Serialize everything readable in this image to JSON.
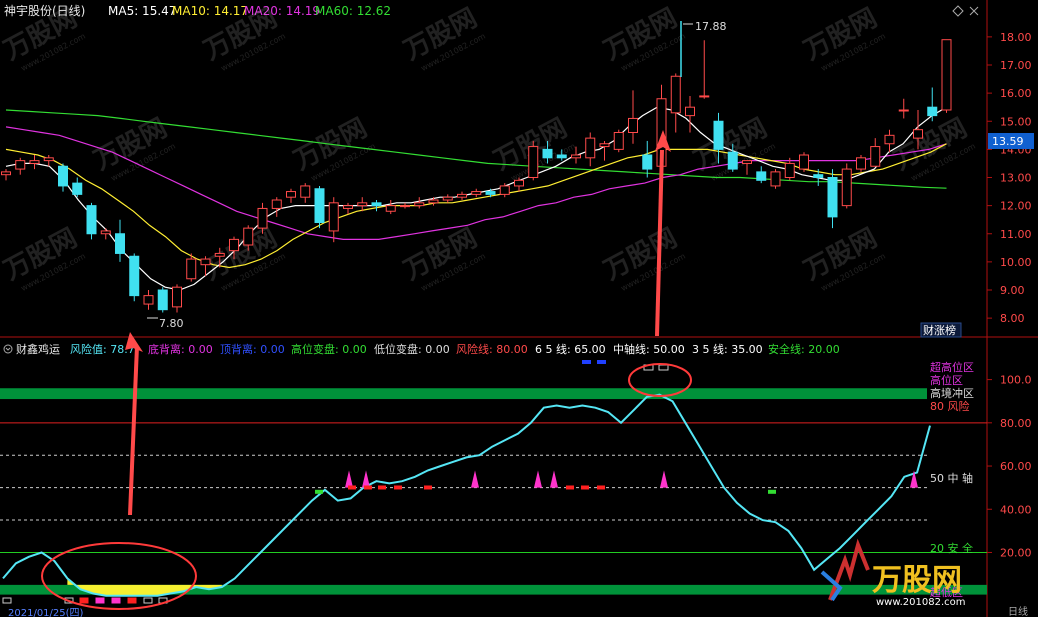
{
  "colors": {
    "background": "#000000",
    "border": "#b01010",
    "candle_up": "#ff4a4a",
    "candle_down": "#40e0f0",
    "ma5": "#ffffff",
    "ma10": "#ffee33",
    "ma20": "#e033e0",
    "ma60": "#33dd33",
    "risk_line": "#55e6f5",
    "green_band": "#00923a",
    "red_line": "#e02020",
    "safety_line": "#22cc22",
    "arrow": "#ff4a4a",
    "current_price_bg": "#1060d0"
  },
  "top_header": {
    "title": "神宇股份(日线)",
    "ma5": "MA5: 15.47",
    "ma10": "MA10: 14.17",
    "ma20": "MA20: 14.19",
    "ma60": "MA60: 12.62"
  },
  "top_panel": {
    "high_label": "17.88",
    "low_label": "7.80",
    "current_price": "13.59",
    "badge": "财涨榜",
    "y_ticks": [
      "18.00",
      "17.00",
      "16.00",
      "15.00",
      "14.00",
      "13.00",
      "12.00",
      "11.00",
      "10.00",
      "9.00",
      "8.00"
    ]
  },
  "bottom_header": {
    "title": "财鑫鸡运",
    "risk": "风险值: 78.7",
    "bottom_div": "底背离: 0.00",
    "top_div": "顶背离: 0.00",
    "high_change": "高位变盘: 0.00",
    "low_change": "低位变盘: 0.00",
    "risk_line": "风险线: 80.00",
    "line65": "6 5 线: 65.00",
    "mid_axis": "中轴线: 50.00",
    "line35": "3 5 线: 35.00",
    "safe_line": "安全线: 20.00"
  },
  "bottom_panel": {
    "zone_labels": {
      "super_high": "超高位区",
      "high_zone": "高位区",
      "high_rush": "高境冲区",
      "risk80": "80 风险",
      "mid50": "50 中 轴",
      "safe20": "20 安 全",
      "low_zone": "超低区"
    },
    "y_ticks": [
      "100.0",
      "80.00",
      "60.00",
      "40.00",
      "20.00"
    ],
    "date_label": "2021/01/25(四)",
    "period_label": "日线"
  },
  "watermark": {
    "brand": "万股网",
    "url": "www.201082.com"
  },
  "chart_data": [
    {
      "type": "candlestick",
      "title": "神宇股份(日线)",
      "ylim": [
        7.4,
        18.6
      ],
      "series_names": [
        "MA5",
        "MA10",
        "MA20",
        "MA60"
      ],
      "candles": [
        [
          13.1,
          13.3,
          12.9,
          13.2
        ],
        [
          13.3,
          13.7,
          13.1,
          13.6
        ],
        [
          13.5,
          13.8,
          13.3,
          13.6
        ],
        [
          13.6,
          13.8,
          13.4,
          13.7
        ],
        [
          13.4,
          13.5,
          12.5,
          12.7
        ],
        [
          12.8,
          13.0,
          12.3,
          12.4
        ],
        [
          12.0,
          12.1,
          10.8,
          11.0
        ],
        [
          11.0,
          11.2,
          10.8,
          11.1
        ],
        [
          11.0,
          11.5,
          10.0,
          10.3
        ],
        [
          10.2,
          10.3,
          8.6,
          8.8
        ],
        [
          8.5,
          9.0,
          8.3,
          8.8
        ],
        [
          9.0,
          9.1,
          8.2,
          8.3
        ],
        [
          8.4,
          9.2,
          8.2,
          9.1
        ],
        [
          9.4,
          10.3,
          9.3,
          10.1
        ],
        [
          9.9,
          10.2,
          9.5,
          10.1
        ],
        [
          10.2,
          10.5,
          9.8,
          10.3
        ],
        [
          10.4,
          10.9,
          10.1,
          10.8
        ],
        [
          10.6,
          11.3,
          10.4,
          11.2
        ],
        [
          11.2,
          12.1,
          11.0,
          11.9
        ],
        [
          11.9,
          12.3,
          11.6,
          12.2
        ],
        [
          12.3,
          12.6,
          12.1,
          12.5
        ],
        [
          12.3,
          12.8,
          12.1,
          12.7
        ],
        [
          12.6,
          12.7,
          11.2,
          11.4
        ],
        [
          11.1,
          12.3,
          10.7,
          12.1
        ],
        [
          11.9,
          12.1,
          11.7,
          12.0
        ],
        [
          12.0,
          12.3,
          11.8,
          12.1
        ],
        [
          12.1,
          12.2,
          11.8,
          12.0
        ],
        [
          11.8,
          12.2,
          11.7,
          12.0
        ],
        [
          12.0,
          12.1,
          11.9,
          12.0
        ],
        [
          12.0,
          12.3,
          11.9,
          12.1
        ],
        [
          12.1,
          12.3,
          12.0,
          12.2
        ],
        [
          12.2,
          12.4,
          12.1,
          12.3
        ],
        [
          12.3,
          12.5,
          12.2,
          12.4
        ],
        [
          12.4,
          12.6,
          12.3,
          12.5
        ],
        [
          12.5,
          12.6,
          12.3,
          12.4
        ],
        [
          12.4,
          12.8,
          12.3,
          12.7
        ],
        [
          12.7,
          13.0,
          12.5,
          12.9
        ],
        [
          13.0,
          14.3,
          12.9,
          14.1
        ],
        [
          14.0,
          14.3,
          13.5,
          13.7
        ],
        [
          13.8,
          14.0,
          13.6,
          13.7
        ],
        [
          13.7,
          14.1,
          13.5,
          13.8
        ],
        [
          13.7,
          14.6,
          13.4,
          14.4
        ],
        [
          14.1,
          14.3,
          13.6,
          14.2
        ],
        [
          14.0,
          14.7,
          13.9,
          14.6
        ],
        [
          14.6,
          16.1,
          14.2,
          15.1
        ],
        [
          13.8,
          14.3,
          13.0,
          13.3
        ],
        [
          13.4,
          16.3,
          13.2,
          15.8
        ],
        [
          15.3,
          16.7,
          14.6,
          16.6
        ],
        [
          15.2,
          15.9,
          14.6,
          15.5
        ],
        [
          15.9,
          17.88,
          15.8,
          15.9
        ],
        [
          15.0,
          15.3,
          13.5,
          14.0
        ],
        [
          13.9,
          14.2,
          13.2,
          13.3
        ],
        [
          13.5,
          13.6,
          13.1,
          13.6
        ],
        [
          13.2,
          13.4,
          12.8,
          12.9
        ],
        [
          12.7,
          13.3,
          12.6,
          13.2
        ],
        [
          13.0,
          13.7,
          12.9,
          13.5
        ],
        [
          13.3,
          13.9,
          13.2,
          13.8
        ],
        [
          13.1,
          13.3,
          12.7,
          13.0
        ],
        [
          13.0,
          13.3,
          11.2,
          11.6
        ],
        [
          12.0,
          13.5,
          11.9,
          13.3
        ],
        [
          13.3,
          13.8,
          13.2,
          13.7
        ],
        [
          13.4,
          14.4,
          13.4,
          14.1
        ],
        [
          14.2,
          14.7,
          13.9,
          14.5
        ],
        [
          15.4,
          15.8,
          15.1,
          15.4
        ],
        [
          14.4,
          15.4,
          14.0,
          14.7
        ],
        [
          15.5,
          16.2,
          15.0,
          15.2
        ],
        [
          15.4,
          16.9,
          15.3,
          17.9
        ]
      ],
      "ma5": [
        13.4,
        13.5,
        13.5,
        13.4,
        12.9,
        12.2,
        11.6,
        11.1,
        10.4,
        9.9,
        9.4,
        9.1,
        9.0,
        9.2,
        9.6,
        10.0,
        10.5,
        11.1,
        11.6,
        11.9,
        12.0,
        12.0,
        12.0,
        12.0,
        12.0,
        12.0,
        12.0,
        12.1,
        12.1,
        12.2,
        12.3,
        12.3,
        12.4,
        12.5,
        12.6,
        12.8,
        13.0,
        13.2,
        13.4,
        13.7,
        13.9,
        14.0,
        14.3,
        14.8,
        15.2,
        15.5,
        15.4,
        15.1,
        14.6,
        14.2,
        14.0,
        13.8,
        13.6,
        13.4,
        13.3,
        13.1,
        13.0,
        12.9,
        12.9,
        13.1,
        13.3,
        13.9,
        14.2,
        14.8,
        15.2,
        15.5
      ],
      "ma10": [
        14.0,
        13.9,
        13.8,
        13.6,
        13.3,
        12.9,
        12.6,
        12.2,
        11.8,
        11.3,
        10.9,
        10.4,
        10.1,
        9.9,
        9.8,
        9.9,
        10.1,
        10.4,
        10.8,
        11.1,
        11.4,
        11.6,
        11.8,
        11.9,
        12.0,
        12.0,
        12.0,
        12.1,
        12.1,
        12.2,
        12.3,
        12.4,
        12.5,
        12.6,
        12.7,
        12.9,
        13.1,
        13.3,
        13.5,
        13.7,
        13.8,
        14.0,
        14.0,
        14.0,
        14.0,
        13.9,
        13.8,
        13.7,
        13.6,
        13.5,
        13.3,
        13.2,
        13.1,
        13.1,
        13.2,
        13.3,
        13.5,
        13.7,
        13.9,
        14.2
      ],
      "ma20": [
        14.8,
        14.7,
        14.6,
        14.5,
        14.3,
        14.1,
        13.9,
        13.6,
        13.3,
        13.0,
        12.7,
        12.4,
        12.1,
        11.8,
        11.6,
        11.4,
        11.2,
        11.0,
        10.9,
        10.8,
        10.8,
        10.8,
        10.9,
        11.0,
        11.1,
        11.2,
        11.3,
        11.5,
        11.6,
        11.8,
        12.0,
        12.1,
        12.3,
        12.4,
        12.6,
        12.7,
        12.8,
        13.0,
        13.1,
        13.3,
        13.4,
        13.5,
        13.6,
        13.6,
        13.6,
        13.6,
        13.6,
        13.6,
        13.6,
        13.7,
        13.8,
        13.9,
        14.0,
        14.2
      ],
      "ma60": [
        15.4,
        15.35,
        15.3,
        15.25,
        15.2,
        15.1,
        15.0,
        14.9,
        14.8,
        14.7,
        14.6,
        14.5,
        14.4,
        14.3,
        14.2,
        14.1,
        14.0,
        13.9,
        13.8,
        13.7,
        13.6,
        13.5,
        13.45,
        13.4,
        13.35,
        13.3,
        13.25,
        13.2,
        13.15,
        13.1,
        13.05,
        13.0,
        13.0,
        12.95,
        12.9,
        12.85,
        12.85,
        12.8,
        12.75,
        12.7,
        12.65,
        12.62
      ]
    },
    {
      "type": "line",
      "title": "财鑫鸡运",
      "ylim": [
        -2,
        110
      ],
      "series": [
        {
          "name": "风险值",
          "values": [
            8,
            15,
            18,
            20,
            16,
            8,
            3,
            1,
            0,
            0,
            0,
            0,
            0,
            1,
            2,
            4,
            3,
            4,
            8,
            14,
            20,
            26,
            32,
            38,
            44,
            49,
            44,
            45,
            50,
            53,
            52,
            53,
            55,
            58,
            60,
            62,
            64,
            65,
            69,
            72,
            75,
            80,
            87,
            88,
            87,
            88,
            87,
            85,
            80,
            86,
            92,
            93,
            90,
            80,
            70,
            60,
            50,
            43,
            38,
            35,
            34,
            30,
            22,
            12,
            17,
            22,
            28,
            34,
            40,
            46,
            55,
            57,
            78.7
          ]
        }
      ],
      "reference_lines": {
        "risk": 80,
        "line65": 65,
        "mid": 50,
        "line35": 35,
        "safe": 20
      }
    }
  ]
}
